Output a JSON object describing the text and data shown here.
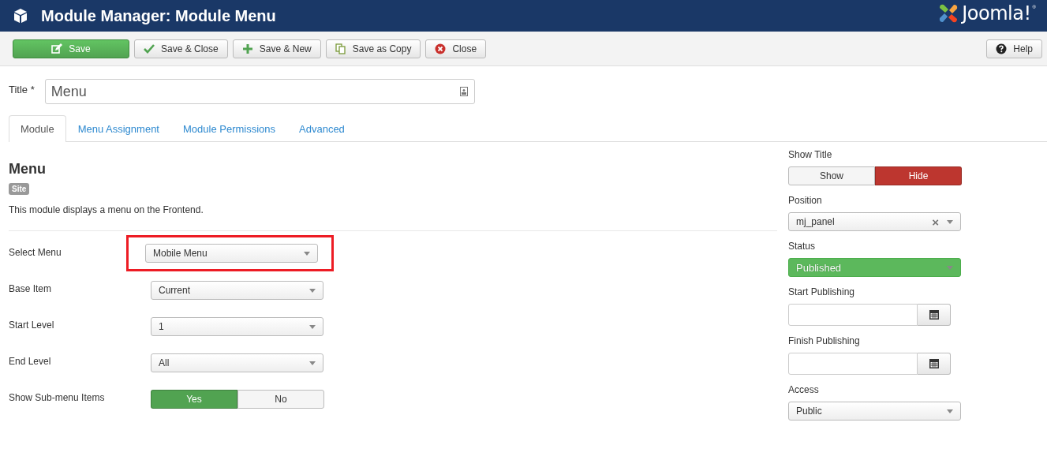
{
  "header": {
    "title": "Module Manager: Module Menu",
    "logo_text": "Joomla!",
    "logo_mark": "®"
  },
  "toolbar": {
    "buttons": [
      {
        "label": "Save",
        "kind": "primary"
      },
      {
        "label": "Save & Close",
        "kind": "default"
      },
      {
        "label": "Save & New",
        "kind": "default"
      },
      {
        "label": "Save as Copy",
        "kind": "default"
      },
      {
        "label": "Close",
        "kind": "default"
      }
    ],
    "help": {
      "label": "Help"
    }
  },
  "title_field": {
    "label": "Title *",
    "value": "Menu"
  },
  "tabs": [
    {
      "label": "Module",
      "selected": true
    },
    {
      "label": "Menu Assignment",
      "selected": false
    },
    {
      "label": "Module Permissions",
      "selected": false
    },
    {
      "label": "Advanced",
      "selected": false
    }
  ],
  "module": {
    "heading": "Menu",
    "badge": "Site",
    "description": "This module displays a menu on the Frontend."
  },
  "fields": [
    {
      "label": "Select Menu",
      "kind": "select",
      "value": "Mobile Menu",
      "highlighted": true
    },
    {
      "label": "Base Item",
      "kind": "select",
      "value": "Current",
      "highlighted": false
    },
    {
      "label": "Start Level",
      "kind": "select",
      "value": "1",
      "highlighted": false
    },
    {
      "label": "End Level",
      "kind": "select",
      "value": "All",
      "highlighted": false
    },
    {
      "label": "Show Sub-menu Items",
      "kind": "toggle",
      "highlighted": false,
      "options": [
        {
          "label": "Yes",
          "selected": true,
          "color": "#51a351"
        },
        {
          "label": "No",
          "selected": false,
          "color": "#f5f5f5"
        }
      ]
    }
  ],
  "sidebar": [
    {
      "label": "Show Title",
      "kind": "toggle",
      "options": [
        {
          "label": "Show",
          "selected": false,
          "color": "#f5f5f5"
        },
        {
          "label": "Hide",
          "selected": true,
          "color": "#bd362f"
        }
      ]
    },
    {
      "label": "Position",
      "kind": "clearable",
      "value": "mj_panel",
      "clear": "×"
    },
    {
      "label": "Status",
      "kind": "status",
      "value": "Published",
      "color": "#5cb85c"
    },
    {
      "label": "Start Publishing",
      "kind": "date"
    },
    {
      "label": "Finish Publishing",
      "kind": "date"
    },
    {
      "label": "Access",
      "kind": "select",
      "value": "Public"
    }
  ]
}
